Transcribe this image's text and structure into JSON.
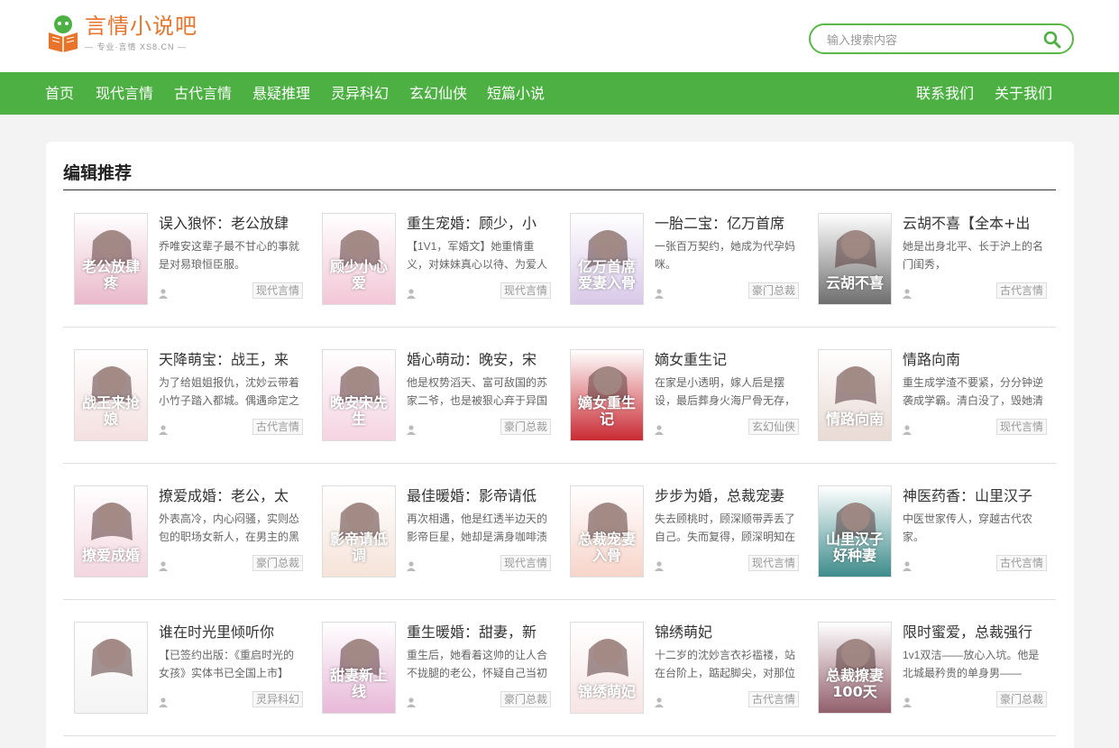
{
  "site": {
    "logo_title": "言情小说吧",
    "logo_sub": "— 专业·言情 XS8.CN —",
    "brand_green": "#4db043",
    "brand_orange": "#e8742b"
  },
  "search": {
    "placeholder": "输入搜索内容",
    "icon": "search-icon"
  },
  "nav": {
    "items": [
      "首页",
      "现代言情",
      "古代言情",
      "悬疑推理",
      "灵异科幻",
      "玄幻仙侠",
      "短篇小说"
    ],
    "right": [
      "联系我们",
      "关于我们"
    ]
  },
  "section": {
    "title": "编辑推荐"
  },
  "books": [
    {
      "title": "误入狼怀：老公放肆",
      "desc": "乔唯安这辈子最不甘心的事就是对易琅恒臣服。",
      "tag": "现代言情",
      "cover_text": "老公放肆疼",
      "cover_color": "#e9b7c9"
    },
    {
      "title": "重生宠婚：顾少，小",
      "desc": "【1V1，军婚文】她重情重义，对妹妹真心以待、为爱人",
      "tag": "现代言情",
      "cover_text": "顾少小心爱",
      "cover_color": "#f2c6d6"
    },
    {
      "title": "一胎二宝：亿万首席",
      "desc": "一张百万契约，她成为代孕妈咪。",
      "tag": "豪门总裁",
      "cover_text": "亿万首席爱妻入骨",
      "cover_color": "#d8c8e8"
    },
    {
      "title": "云胡不喜【全本+出",
      "desc": "她是出身北平、长于沪上的名门闺秀，",
      "tag": "古代言情",
      "cover_text": "云胡不喜",
      "cover_color": "#6b6b6b"
    },
    {
      "title": "天降萌宝：战王，来",
      "desc": "为了给姐姐报仇，沈妙云带着小竹子踏入都城。偶遇命定之",
      "tag": "古代言情",
      "cover_text": "战王来抢娘",
      "cover_color": "#f4dfe0"
    },
    {
      "title": "婚心萌动：晚安，宋",
      "desc": "他是权势滔天、富可敌国的苏家二爷，也是被狠心弃于异国",
      "tag": "豪门总裁",
      "cover_text": "晚安宋先生",
      "cover_color": "#f5d3e1"
    },
    {
      "title": "嫡女重生记",
      "desc": "在家是小透明，嫁人后是摆设，最后葬身火海尸骨无存，",
      "tag": "玄幻仙侠",
      "cover_text": "嫡女重生记",
      "cover_color": "#c8262f"
    },
    {
      "title": "情路向南",
      "desc": "重生成学渣不要紧，分分钟逆袭成学霸。清白没了，毁她清",
      "tag": "现代言情",
      "cover_text": "情路向南",
      "cover_color": "#e8d9d3"
    },
    {
      "title": "撩爱成婚：老公，太",
      "desc": "外表高冷，内心闷骚，实则怂包的职场女新人，在男主的黑",
      "tag": "豪门总裁",
      "cover_text": "撩爱成婚",
      "cover_color": "#f3d5df"
    },
    {
      "title": "最佳暖婚：影帝请低",
      "desc": "再次相遇，他是红透半边天的影帝巨星，她却是满身咖啡渍",
      "tag": "现代言情",
      "cover_text": "影帝请低调",
      "cover_color": "#f5e3d8"
    },
    {
      "title": "步步为婚，总裁宠妻",
      "desc": "失去顾桃时，顾深顺带弄丢了自己。失而复得，顾深明知在",
      "tag": "现代言情",
      "cover_text": "总裁宠妻入骨",
      "cover_color": "#f7d4c9"
    },
    {
      "title": "神医药香：山里汉子",
      "desc": "中医世家传人，穿越古代农家。",
      "tag": "古代言情",
      "cover_text": "山里汉子好种妻",
      "cover_color": "#3b8a8a"
    },
    {
      "title": "谁在时光里倾听你",
      "desc": "【已签约出版：《重启时光的女孩》实体书已全国上市】",
      "tag": "灵异科幻",
      "cover_text": "",
      "cover_color": "#f4f4f4"
    },
    {
      "title": "重生暖婚：甜妻，新",
      "desc": "重生后，她看着这帅的让人合不拢腿的老公，怀疑自己当初",
      "tag": "豪门总裁",
      "cover_text": "甜妻新上线",
      "cover_color": "#e7b7d7"
    },
    {
      "title": "锦绣萌妃",
      "desc": "十二岁的沈妙言衣衫褴褛，站在台阶上，踮起脚尖，对那位",
      "tag": "古代言情",
      "cover_text": "锦绣萌妃",
      "cover_color": "#f7e4e4"
    },
    {
      "title": "限时蜜爱，总裁强行",
      "desc": "1v1双洁——放心入坑。他是北城最矜贵的单身男——",
      "tag": "豪门总裁",
      "cover_text": "总裁撩妻100天",
      "cover_color": "#8f5c6a"
    }
  ]
}
